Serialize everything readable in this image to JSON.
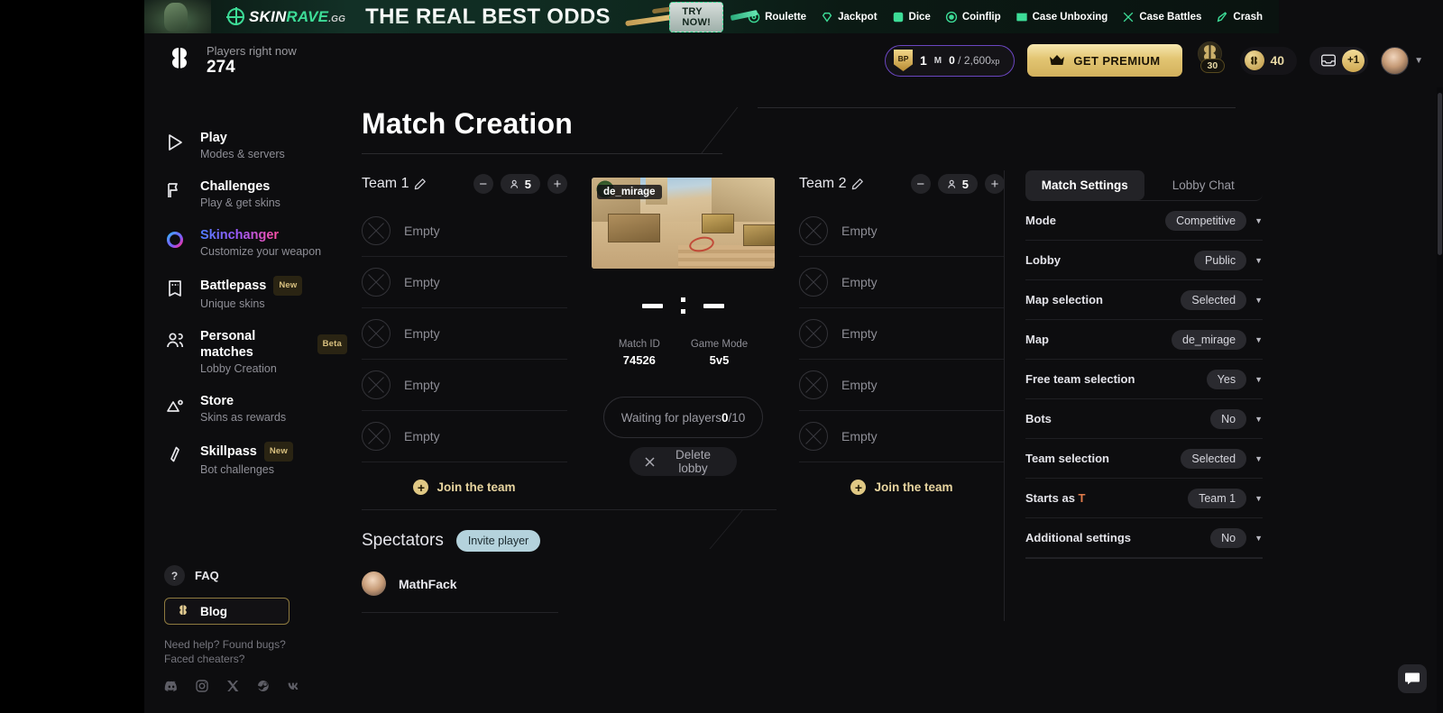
{
  "banner": {
    "brand_prefix": "SKIN",
    "brand_accent": "RAVE",
    "brand_suffix": ".GG",
    "headline": "THE REAL BEST ODDS",
    "cta": "TRY NOW!",
    "links": [
      {
        "label": "Roulette",
        "icon": "roulette-icon"
      },
      {
        "label": "Jackpot",
        "icon": "diamond-icon"
      },
      {
        "label": "Dice",
        "icon": "dice-icon"
      },
      {
        "label": "Coinflip",
        "icon": "coin-icon"
      },
      {
        "label": "Case Unboxing",
        "icon": "case-icon"
      },
      {
        "label": "Case Battles",
        "icon": "swords-icon"
      },
      {
        "label": "Crash",
        "icon": "rocket-icon"
      }
    ]
  },
  "header": {
    "logo_icon": "butterfly-logo-icon",
    "players_label": "Players right now",
    "players_count": "274",
    "battlepass": {
      "badge": "BP",
      "level": "1",
      "level_suffix": "M",
      "xp_current": "0",
      "xp_separator": "/",
      "xp_total": "2,600",
      "xp_unit": "xp"
    },
    "premium_label": "GET PREMIUM",
    "premium_icon": "crown-icon",
    "coin_stack_badge": "30",
    "coin_value": "40",
    "inbox_icon": "inbox-icon",
    "inbox_badge": "+1",
    "avatar_icon": "avatar",
    "chevron_icon": "chevron-down-icon"
  },
  "sidebar": {
    "items": [
      {
        "title": "Play",
        "subtitle": "Modes & servers",
        "icon": "play-icon",
        "tag": ""
      },
      {
        "title": "Challenges",
        "subtitle": "Play & get skins",
        "icon": "flag-icon",
        "tag": ""
      },
      {
        "title": "Skinchanger",
        "subtitle": "Customize your weapon",
        "icon": "skinchanger-icon",
        "tag": ""
      },
      {
        "title": "Battlepass",
        "subtitle": "Unique skins",
        "icon": "battlepass-icon",
        "tag": "New"
      },
      {
        "title": "Personal matches",
        "subtitle": "Lobby Creation",
        "icon": "users-icon",
        "tag": "Beta"
      },
      {
        "title": "Store",
        "subtitle": "Skins as rewards",
        "icon": "store-icon",
        "tag": ""
      },
      {
        "title": "Skillpass",
        "subtitle": "Bot challenges",
        "icon": "skillpass-icon",
        "tag": "New"
      }
    ],
    "faq_label": "FAQ",
    "faq_icon": "question-icon",
    "blog_label": "Blog",
    "blog_icon": "butterfly-logo-icon",
    "help_line1": "Need help? Found bugs?",
    "help_line2": "Faced cheaters?",
    "socials": [
      {
        "icon": "discord-icon"
      },
      {
        "icon": "instagram-icon"
      },
      {
        "icon": "x-twitter-icon"
      },
      {
        "icon": "steam-icon"
      },
      {
        "icon": "vk-icon"
      }
    ]
  },
  "main": {
    "page_title": "Match Creation",
    "team1": {
      "name": "Team 1",
      "edit_icon": "pencil-icon",
      "minus": "−",
      "plus": "+",
      "count": "5",
      "slots": [
        "Empty",
        "Empty",
        "Empty",
        "Empty",
        "Empty"
      ],
      "join_label": "Join the team"
    },
    "team2": {
      "name": "Team 2",
      "edit_icon": "pencil-icon",
      "minus": "−",
      "plus": "+",
      "count": "5",
      "slots": [
        "Empty",
        "Empty",
        "Empty",
        "Empty",
        "Empty"
      ],
      "join_label": "Join the team"
    },
    "center": {
      "map_chip": "de_mirage",
      "score_left": "",
      "score_right": "",
      "meta": [
        {
          "key": "Match ID",
          "value": "74526"
        },
        {
          "key": "Game Mode",
          "value": "5v5"
        }
      ],
      "waiting_prefix": "Waiting for players ",
      "waiting_current": "0",
      "waiting_total": "/10",
      "delete_label": "Delete lobby",
      "delete_icon": "close-icon"
    },
    "spectators": {
      "title": "Spectators",
      "invite_label": "Invite player",
      "list": [
        {
          "name": "MathFack"
        }
      ]
    },
    "settings": {
      "tabs": [
        {
          "label": "Match Settings",
          "active": true
        },
        {
          "label": "Lobby Chat",
          "active": false
        }
      ],
      "rows": [
        {
          "key": "Mode",
          "value": "Competitive"
        },
        {
          "key": "Lobby",
          "value": "Public"
        },
        {
          "key": "Map selection",
          "value": "Selected"
        },
        {
          "key": "Map",
          "value": "de_mirage"
        },
        {
          "key": "Free team selection",
          "value": "Yes"
        },
        {
          "key": "Bots",
          "value": "No"
        },
        {
          "key": "Team selection",
          "value": "Selected"
        },
        {
          "key": "Starts as T",
          "value": "Team 1",
          "key_accent": "T"
        },
        {
          "key": "Additional settings",
          "value": "No"
        }
      ]
    }
  },
  "chat_widget": {
    "icon": "chat-bubble-icon"
  },
  "colors": {
    "background": "#0d0d0f",
    "gold": "#e0c884",
    "accent_green": "#3ddc97",
    "terrorist_orange": "#e07b4a",
    "invite_blue": "#b4d2dc"
  }
}
